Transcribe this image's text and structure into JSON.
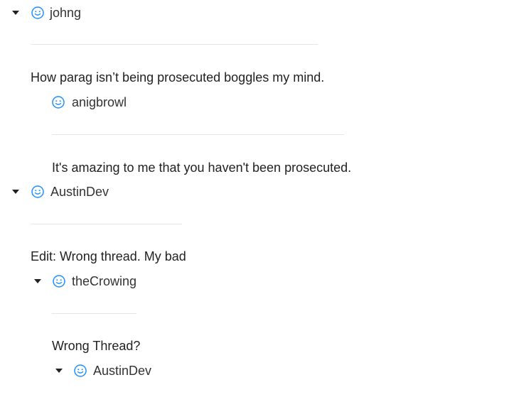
{
  "comments": [
    {
      "username": "johng",
      "text": "How parag isn’t being prosecuted boggles my mind.",
      "expanded": true
    },
    {
      "username": "anigbrowl",
      "text": "It's amazing to me that you haven't been prosecuted.",
      "expanded": null
    },
    {
      "username": "AustinDev",
      "text": "Edit: Wrong thread. My bad",
      "expanded": true
    },
    {
      "username": "theCrowing",
      "text": "Wrong Thread?",
      "expanded": true
    },
    {
      "username": "AustinDev",
      "text": "",
      "expanded": true
    }
  ],
  "colors": {
    "avatar_accent": "#1e90ff",
    "divider": "#e6e6e6",
    "text": "#222222"
  },
  "icons": {
    "toggle": "caret-down-icon",
    "avatar": "smiley-face-icon"
  }
}
